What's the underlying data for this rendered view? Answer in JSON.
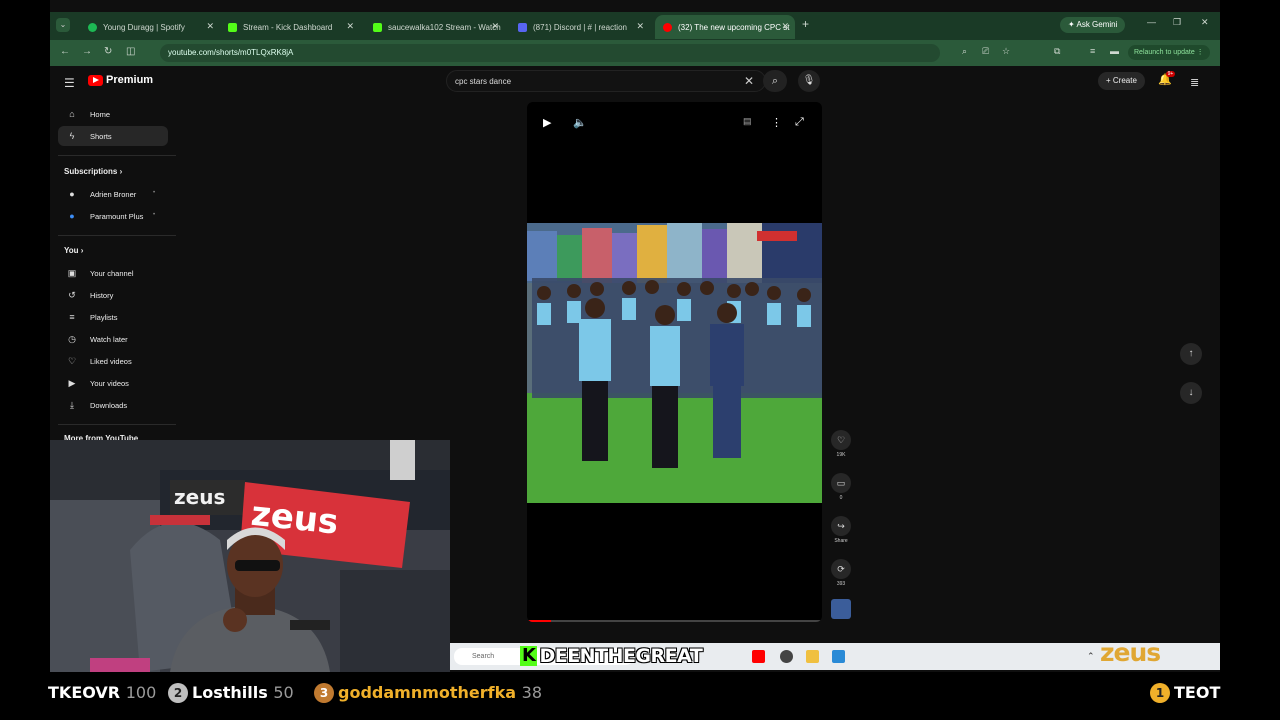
{
  "browser": {
    "tabs": [
      {
        "title": "Young Duragg | Spotify",
        "color": "#1db954"
      },
      {
        "title": "Stream - Kick Dashboard",
        "color": "#53fc18"
      },
      {
        "title": "saucewalka102 Stream - Watch",
        "color": "#53fc18"
      },
      {
        "title": "(871) Discord | # | reaction",
        "color": "#5865f2"
      },
      {
        "title": "(32) The new upcoming CPC st",
        "color": "#ff0000"
      }
    ],
    "new_tab": "+",
    "ask_gemini": "Ask Gemini",
    "url": "youtube.com/shorts/m0TLQxRK8jA",
    "relaunch": "Relaunch to update"
  },
  "youtube": {
    "logo_text": "Premium",
    "search_value": "cpc stars dance",
    "create_label": "Create",
    "notif_count": "9+",
    "sidebar": {
      "main": [
        {
          "label": "Home",
          "icon": "home-icon",
          "glyph": "⌂"
        },
        {
          "label": "Shorts",
          "icon": "shorts-icon",
          "glyph": "▶"
        }
      ],
      "subscriptions_title": "Subscriptions",
      "subscriptions": [
        {
          "label": "Adrien Broner"
        },
        {
          "label": "Paramount Plus"
        }
      ],
      "you_title": "You",
      "you": [
        {
          "label": "Your channel",
          "glyph": "▣"
        },
        {
          "label": "History",
          "glyph": "↺"
        },
        {
          "label": "Playlists",
          "glyph": "≡"
        },
        {
          "label": "Watch later",
          "glyph": "◷"
        },
        {
          "label": "Liked videos",
          "glyph": "♡"
        },
        {
          "label": "Your videos",
          "glyph": "▶"
        },
        {
          "label": "Downloads",
          "glyph": "⤓"
        }
      ],
      "more_title": "More from YouTube"
    },
    "short": {
      "progress": 0.08,
      "actions": [
        {
          "name": "like",
          "glyph": "♡",
          "label": "19K"
        },
        {
          "name": "comments",
          "glyph": "▭",
          "label": "0"
        },
        {
          "name": "share",
          "glyph": "↪",
          "label": "Share"
        },
        {
          "name": "remix",
          "glyph": "⟳",
          "label": "393"
        }
      ]
    }
  },
  "taskbar": {
    "search_placeholder": "Search"
  },
  "stream_overlay": {
    "kick_username": "DEENTHEGREAT",
    "kick_letter": "K",
    "sponsor": "zeus",
    "webcam_banner": "zeus",
    "leaderboard": [
      {
        "rank": "",
        "name": "TKEOVR",
        "count": "100"
      },
      {
        "rank": "2",
        "name": "Losthills",
        "count": "50"
      },
      {
        "rank": "3",
        "name": "goddamnmotherfka",
        "count": "38"
      },
      {
        "rank": "1",
        "name": "TEOT",
        "count": ""
      }
    ]
  }
}
